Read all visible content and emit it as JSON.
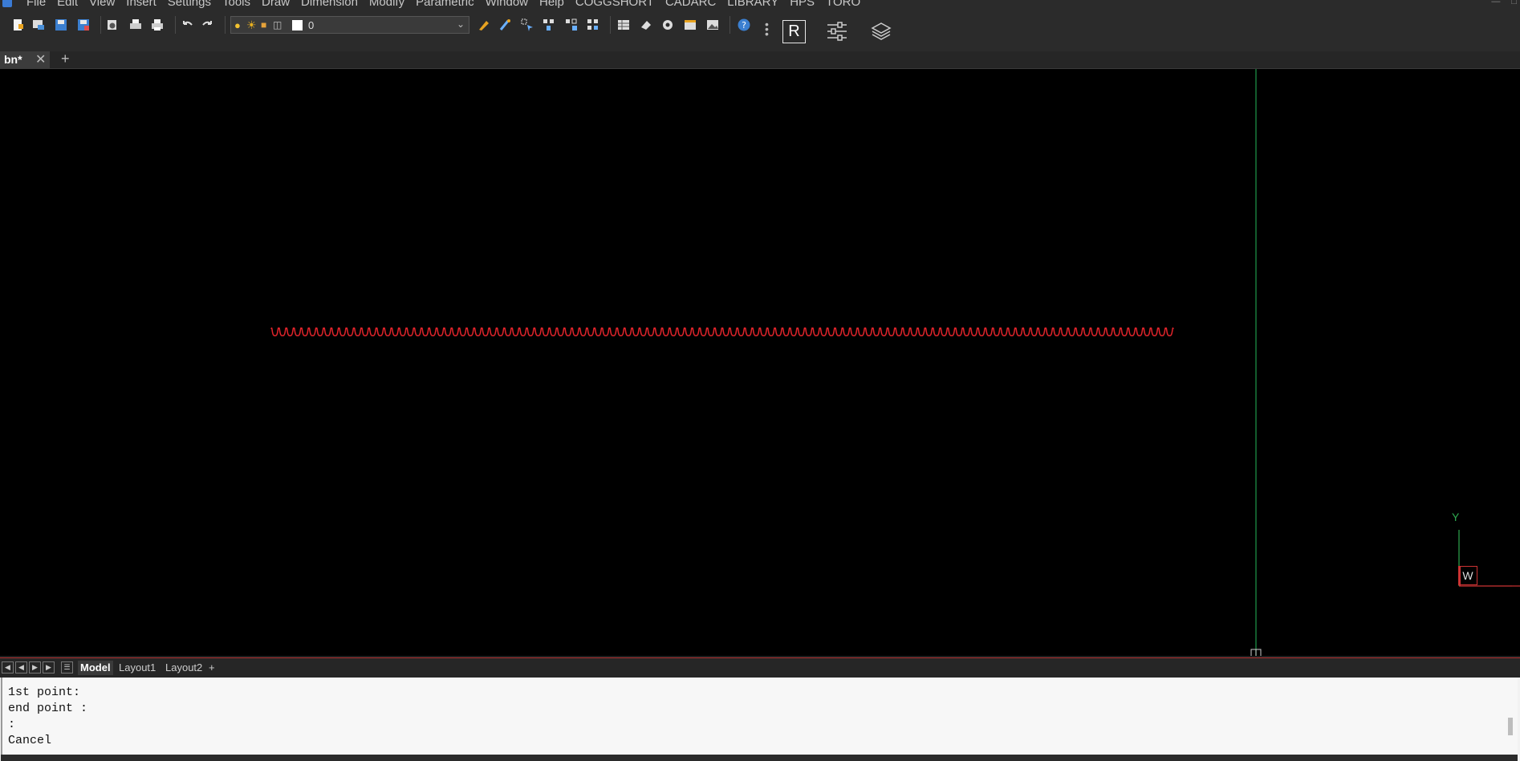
{
  "menu": {
    "items": [
      "File",
      "Edit",
      "View",
      "Insert",
      "Settings",
      "Tools",
      "Draw",
      "Dimension",
      "Modify",
      "Parametric",
      "Window",
      "Help",
      "COGGSHORT",
      "CADARC",
      "LIBRARY",
      "HPS",
      "TORO"
    ]
  },
  "toolbar": {
    "layer_name": "0",
    "r_button_label": "R",
    "icons": [
      "new-drawing",
      "open",
      "save",
      "save-as",
      "print-preview",
      "print",
      "plot",
      "undo",
      "redo",
      "layer-properties",
      "layer-match",
      "quick-select",
      "select-similar",
      "select-previous",
      "select-all",
      "table",
      "erase",
      "settings",
      "properties",
      "image",
      "help"
    ]
  },
  "document_tabs": {
    "active": "bn*",
    "add_label": "+"
  },
  "canvas": {
    "background": "#000000",
    "wave_color": "#e0242b",
    "crosshair_color": "#1f9a4a",
    "ucs_label": "W",
    "ucs_y": "Y"
  },
  "layout_tabs": {
    "tabs": [
      "Model",
      "Layout1",
      "Layout2"
    ],
    "active": "Model",
    "add_label": "+"
  },
  "command": {
    "history": [
      "1st point:",
      "end point :",
      ":",
      "Cancel"
    ]
  }
}
